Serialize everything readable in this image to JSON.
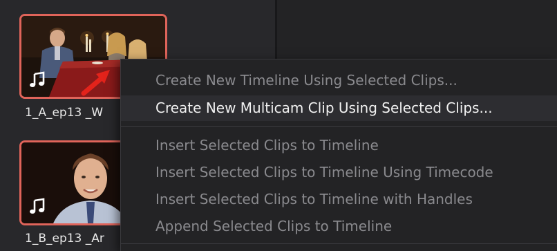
{
  "media_pool": {
    "clips": [
      {
        "name": "1_A_ep13 _W",
        "has_audio": true,
        "selected": true,
        "audio_icon": "music-note-icon"
      },
      {
        "name": "1_B_ep13 _Ar",
        "has_audio": true,
        "selected": true,
        "audio_icon": "music-note-icon"
      }
    ]
  },
  "context_menu": {
    "items": [
      {
        "label": "Create New Timeline Using Selected Clips...",
        "enabled": false
      },
      {
        "label": "Create New Multicam Clip Using Selected Clips...",
        "enabled": true,
        "highlighted": true
      },
      {
        "label": "Insert Selected Clips to Timeline",
        "enabled": false
      },
      {
        "label": "Insert Selected Clips to Timeline Using Timecode",
        "enabled": false
      },
      {
        "label": "Insert Selected Clips to Timeline with Handles",
        "enabled": false
      },
      {
        "label": "Append Selected Clips to Timeline",
        "enabled": false
      }
    ]
  },
  "colors": {
    "selection_border": "#e0645a",
    "annotation_arrow": "#e3231b",
    "menu_text_enabled": "#f2f2f2",
    "menu_text_disabled": "#8a8a8e"
  }
}
